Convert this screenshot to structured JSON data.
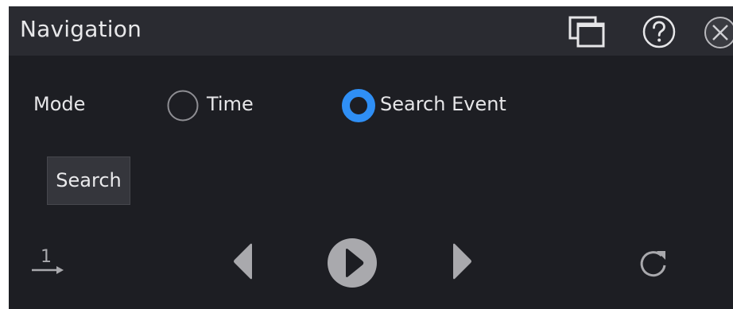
{
  "window": {
    "title": "Navigation"
  },
  "titlebar": {
    "icons": [
      "restore-windows-icon",
      "help-icon",
      "close-icon"
    ]
  },
  "mode": {
    "label": "Mode",
    "options": [
      {
        "label": "Time",
        "selected": false
      },
      {
        "label": "Search Event",
        "selected": true
      }
    ]
  },
  "search_button": {
    "label": "Search"
  },
  "playback": {
    "step_label": "1",
    "icons": [
      "step-number-icon",
      "previous-icon",
      "play-icon",
      "next-icon",
      "reset-icon"
    ]
  },
  "colors": {
    "accent": "#2f8ff5",
    "background": "#1d1e23",
    "titlebar": "#2a2b31",
    "button_bg": "#35363c",
    "icon_gray": "#a9a9ad"
  }
}
